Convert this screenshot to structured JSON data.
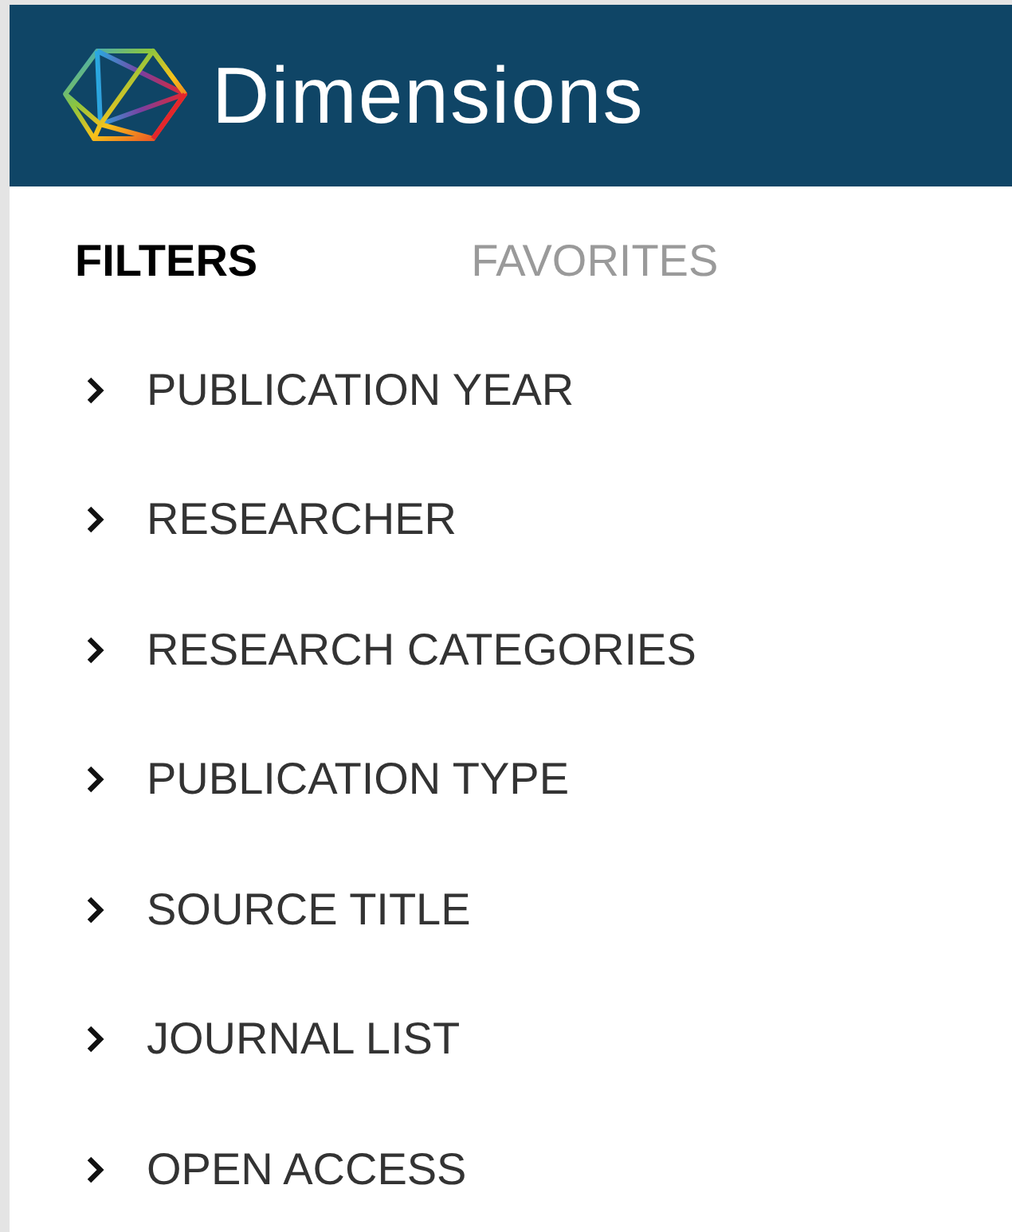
{
  "header": {
    "title": "Dimensions"
  },
  "tabs": [
    {
      "label": "FILTERS",
      "selected": true
    },
    {
      "label": "FAVORITES",
      "selected": false
    }
  ],
  "filters": [
    {
      "label": "PUBLICATION YEAR",
      "expanded": false
    },
    {
      "label": "RESEARCHER",
      "expanded": false
    },
    {
      "label": "RESEARCH CATEGORIES",
      "expanded": false
    },
    {
      "label": "PUBLICATION TYPE",
      "expanded": false
    },
    {
      "label": "SOURCE TITLE",
      "expanded": false
    },
    {
      "label": "JOURNAL LIST",
      "expanded": false
    },
    {
      "label": "OPEN ACCESS",
      "expanded": false
    }
  ]
}
